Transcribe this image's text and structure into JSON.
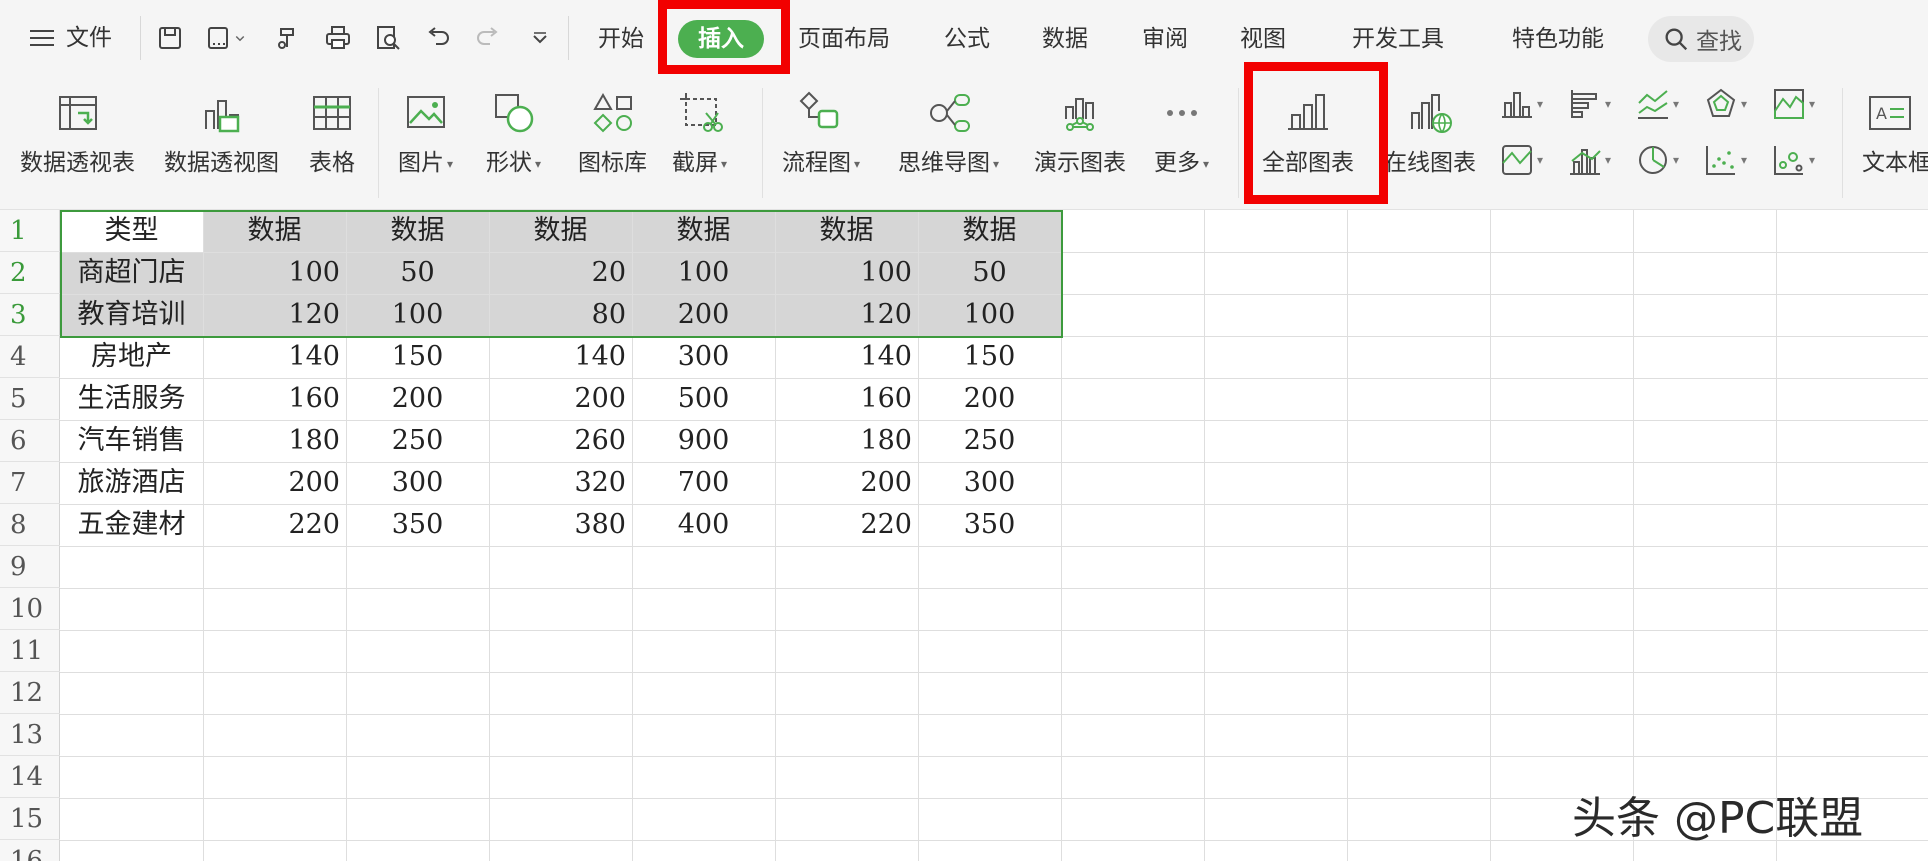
{
  "menubar": {
    "file_label": "文件",
    "tabs": [
      "开始",
      "插入",
      "页面布局",
      "公式",
      "数据",
      "审阅",
      "视图",
      "开发工具",
      "特色功能"
    ],
    "active_tab": "插入",
    "search_label": "查找"
  },
  "ribbon": {
    "buttons": [
      "数据透视表",
      "数据透视图",
      "表格",
      "图片",
      "形状",
      "图标库",
      "截屏",
      "流程图",
      "思维导图",
      "演示图表",
      "更多",
      "全部图表",
      "在线图表",
      "文本框"
    ]
  },
  "sheet": {
    "row_numbers": [
      "1",
      "2",
      "3",
      "4",
      "5",
      "6",
      "7",
      "8",
      "9",
      "10",
      "11",
      "12",
      "13",
      "14",
      "15",
      "16"
    ],
    "header": [
      "类型",
      "数据",
      "数据",
      "数据",
      "数据",
      "数据",
      "数据"
    ],
    "rows": [
      [
        "商超门店",
        "100",
        "50",
        "20",
        "100",
        "100",
        "50"
      ],
      [
        "教育培训",
        "120",
        "100",
        "80",
        "200",
        "120",
        "100"
      ],
      [
        "房地产",
        "140",
        "150",
        "140",
        "300",
        "140",
        "150"
      ],
      [
        "生活服务",
        "160",
        "200",
        "200",
        "500",
        "160",
        "200"
      ],
      [
        "汽车销售",
        "180",
        "250",
        "260",
        "900",
        "180",
        "250"
      ],
      [
        "旅游酒店",
        "200",
        "300",
        "320",
        "700",
        "200",
        "300"
      ],
      [
        "五金建材",
        "220",
        "350",
        "380",
        "400",
        "220",
        "350"
      ]
    ]
  },
  "watermark": "头条 @PC联盟",
  "colors": {
    "accent_green": "#4caf50",
    "highlight_red": "#f20000",
    "selection_fill": "#d6d6d6"
  }
}
